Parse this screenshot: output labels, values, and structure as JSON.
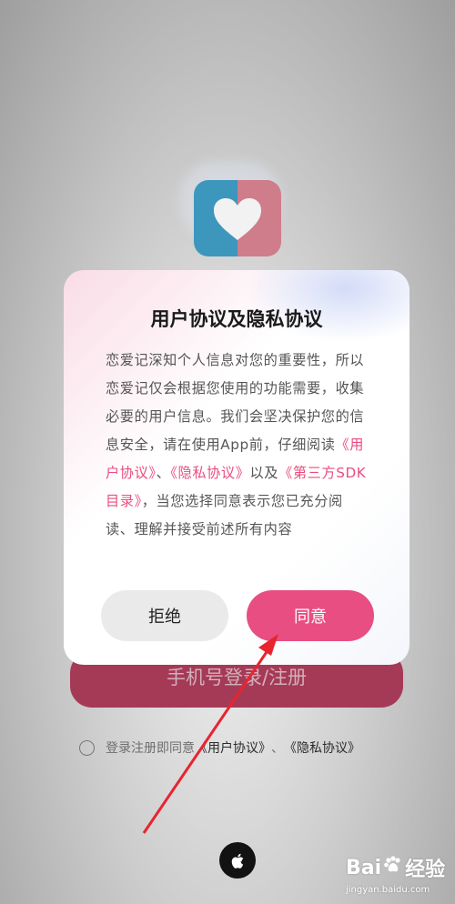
{
  "login_page": {
    "phone_button_label": "手机号登录/注册",
    "consent_prefix": "登录注册即同意",
    "user_agreement_link": "《用户协议》",
    "separator": "、",
    "privacy_link": "《隐私协议》"
  },
  "dialog": {
    "title": "用户协议及隐私协议",
    "body_part1": "恋爱记深知个人信息对您的重要性，所以恋爱记仅会根据您使用的功能需要，收集必要的用户信息。我们会坚决保护您的信息安全，请在使用App前，仔细阅读",
    "link_user_agreement": "《用户协议》",
    "sep": "、",
    "link_privacy": "《隐私协议》",
    "and_text": "以及",
    "link_sdk": "《第三方SDK目录》",
    "body_part2": "，当您选择同意表示您已充分阅读、理解并接受前述所有内容",
    "refuse_label": "拒绝",
    "agree_label": "同意"
  },
  "watermark": {
    "brand_left": "Bai",
    "brand_right": "经验",
    "url": "jingyan.baidu.com"
  },
  "colors": {
    "accent_pink": "#e84e81",
    "phone_button": "#a53a57",
    "logo_blue": "#3d97bd",
    "logo_pink": "#cf7d8a",
    "arrow_red": "#e8242f"
  },
  "icons": [
    "heart-logo-icon",
    "apple-icon",
    "baidu-paw-icon",
    "red-arrow-annotation"
  ]
}
